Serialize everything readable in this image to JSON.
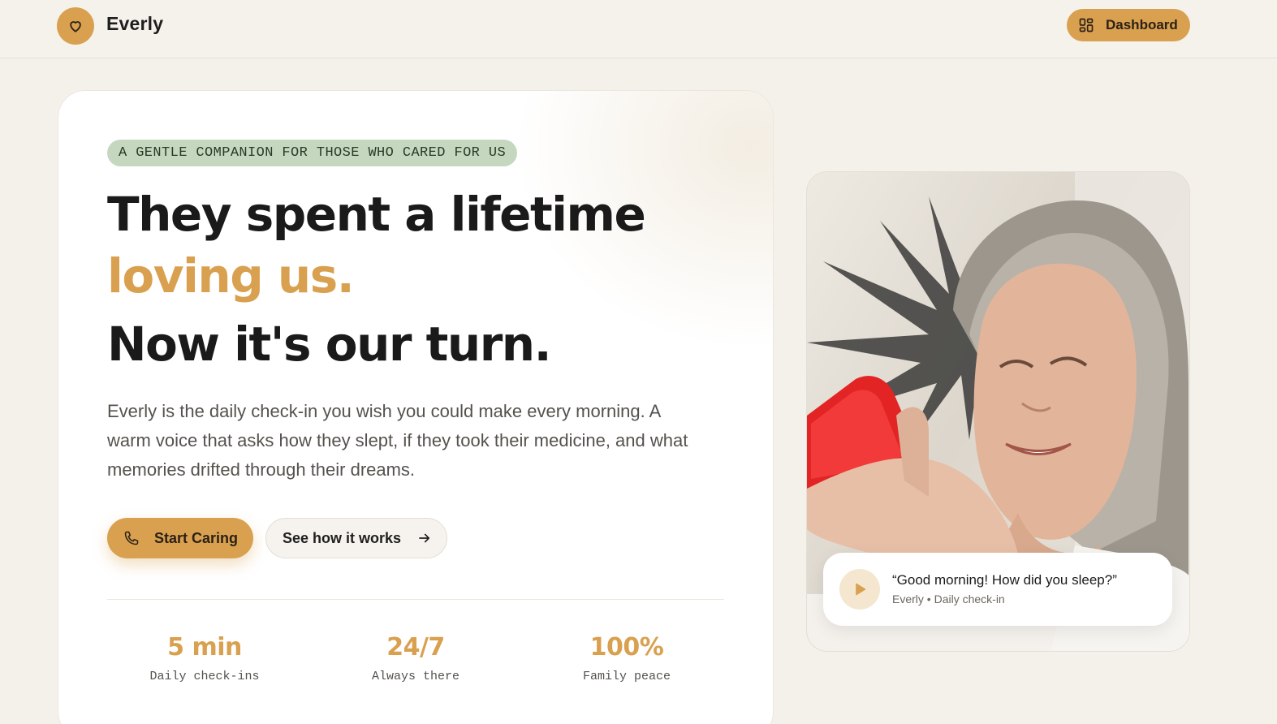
{
  "brand": {
    "name": "Everly",
    "accent": "#d9a04f",
    "tag_bg": "#c5d8bf",
    "icon": "heart-icon"
  },
  "nav": {
    "dashboard_label": "Dashboard",
    "dashboard_icon": "grid-icon"
  },
  "hero": {
    "tagline": "A GENTLE COMPANION FOR THOSE WHO CARED FOR US",
    "headline_line1": "They spent a lifetime",
    "headline_line2": "loving us.",
    "headline_line3": "Now it's our turn.",
    "lead": "Everly is the daily check-in you wish you could make every morning. A warm voice that asks how they slept, if they took their medicine, and what memories drifted through their dreams.",
    "primary_cta": "Start Caring",
    "primary_icon": "phone-icon",
    "secondary_cta": "See how it works",
    "secondary_icon": "arrow-right-icon"
  },
  "stats": [
    {
      "value": "5 min",
      "label": "Daily check-ins"
    },
    {
      "value": "24/7",
      "label": "Always there"
    },
    {
      "value": "100%",
      "label": "Family peace"
    }
  ],
  "photo_card": {
    "quote": "“Good morning! How did you sleep?”",
    "meta": "Everly • Daily check-in",
    "play_icon": "play-icon"
  }
}
